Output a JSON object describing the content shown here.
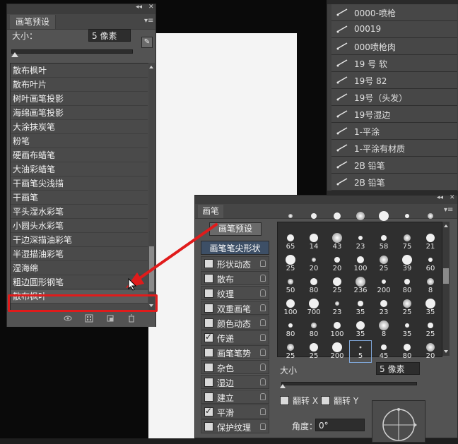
{
  "preset_panel": {
    "tab": "画笔预设",
    "size_label": "大小：",
    "size_value": "5 像素",
    "items": [
      "散布枫叶",
      "散布叶片",
      "树叶画笔投影",
      "海绵画笔投影",
      "大涂抹炭笔",
      "粉笔",
      "硬画布蜡笔",
      "大油彩蜡笔",
      "干画笔尖浅描",
      "干画笔",
      "平头湿水彩笔",
      "小圆头水彩笔",
      "干边深描油彩笔",
      "半湿描油彩笔",
      "湿海绵",
      "粗边圆形钢笔",
      "散布枫叶"
    ]
  },
  "right_list": {
    "items": [
      "0000-喷枪",
      "00019",
      "000喷枪肉",
      "19 号 软",
      "19号 82",
      "19号（头发）",
      "19号湿边",
      "1-平涂",
      "1-平涂有材质",
      "2B 铅笔",
      "2B 铅笔"
    ]
  },
  "brush_panel": {
    "tab": "画笔",
    "preset_button": "画笔预设",
    "tip_shape_header": "画笔笔尖形状",
    "options": [
      {
        "label": "形状动态",
        "checked": false
      },
      {
        "label": "散布",
        "checked": false
      },
      {
        "label": "纹理",
        "checked": false
      },
      {
        "label": "双重画笔",
        "checked": false
      },
      {
        "label": "颜色动态",
        "checked": false
      },
      {
        "label": "传递",
        "checked": true
      },
      {
        "label": "画笔笔势",
        "checked": false
      },
      {
        "label": "杂色",
        "checked": false
      },
      {
        "label": "湿边",
        "checked": false
      },
      {
        "label": "建立",
        "checked": false
      },
      {
        "label": "平滑",
        "checked": true
      },
      {
        "label": "保护纹理",
        "checked": false
      }
    ],
    "tips": [
      [
        "",
        "",
        "",
        "",
        "",
        "",
        ""
      ],
      [
        "65",
        "14",
        "43",
        "23",
        "58",
        "75",
        "21"
      ],
      [
        "25",
        "20",
        "20",
        "100",
        "25",
        "39",
        "60"
      ],
      [
        "50",
        "80",
        "25",
        "236",
        "200",
        "80",
        "8"
      ],
      [
        "100",
        "700",
        "23",
        "35",
        "23",
        "25",
        "35"
      ],
      [
        "80",
        "80",
        "100",
        "35",
        "8",
        "35",
        "25"
      ],
      [
        "25",
        "25",
        "200",
        "5",
        "45",
        "80",
        "20"
      ]
    ],
    "size_label": "大小",
    "size_value": "5 像素",
    "flip_x": "翻转 X",
    "flip_y": "翻转 Y",
    "angle_label": "角度：",
    "angle_value": "0°"
  },
  "colors": {
    "highlight": "#e01b1b",
    "selected_option": "#3d4f66"
  }
}
